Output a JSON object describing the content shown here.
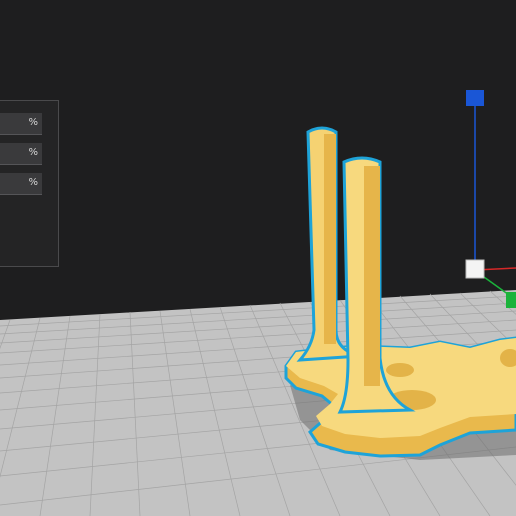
{
  "scale_panel": {
    "fields": [
      {
        "unit": "%"
      },
      {
        "unit": "%"
      },
      {
        "unit": "%"
      }
    ]
  },
  "colors": {
    "background": "#1e1e1f",
    "build_plate": "#bdbdbd",
    "model": "#f6d57a",
    "model_outline": "#1ea3d8",
    "gizmo_z": "#1a56d6",
    "gizmo_y": "#1bb33b",
    "gizmo_x": "#d62828"
  },
  "icons": [
    "z-axis-handle-icon",
    "origin-handle-icon",
    "y-axis-handle-icon",
    "x-axis-handle-icon"
  ]
}
